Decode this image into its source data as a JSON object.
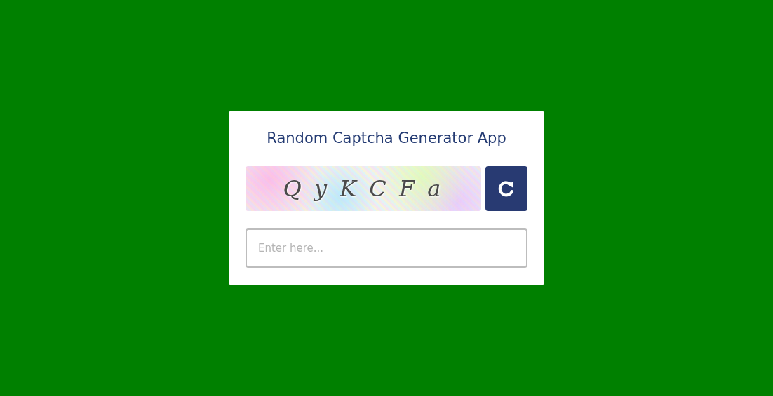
{
  "title": "Random Captcha Generator App",
  "captcha": {
    "text": "Q y K C F a"
  },
  "input": {
    "placeholder": "Enter here..."
  }
}
